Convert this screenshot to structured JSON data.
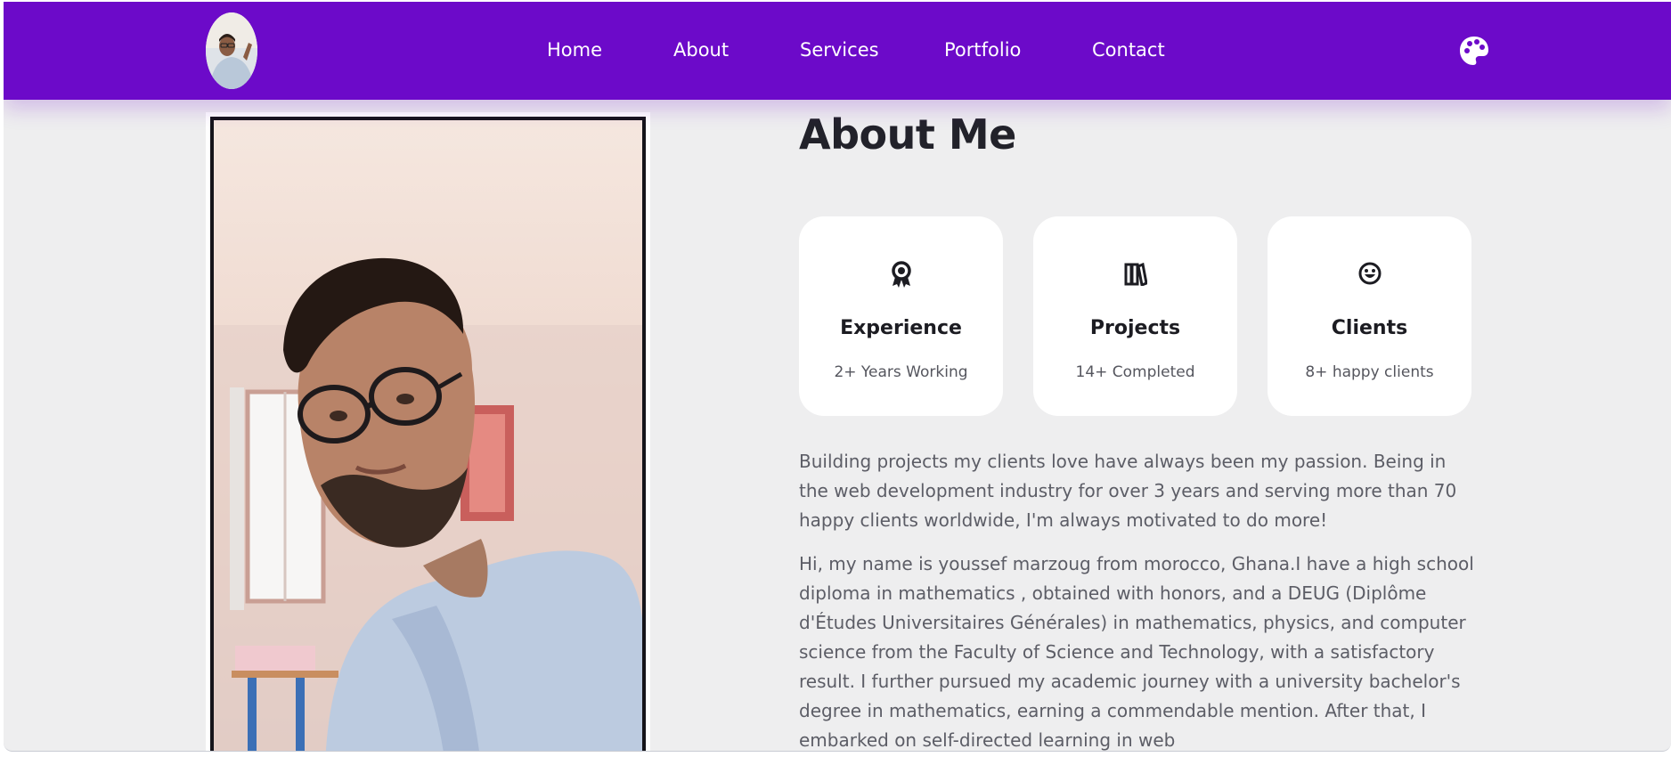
{
  "nav": {
    "logo_alt": "profile photo",
    "links": [
      {
        "label": "Home"
      },
      {
        "label": "About"
      },
      {
        "label": "Services"
      },
      {
        "label": "Portfolio"
      },
      {
        "label": "Contact"
      }
    ],
    "theme_icon": "palette-icon"
  },
  "about": {
    "title": "About Me",
    "cards": [
      {
        "icon": "award-icon",
        "title": "Experience",
        "subtitle": "2+ Years Working"
      },
      {
        "icon": "books-icon",
        "title": "Projects",
        "subtitle": "14+ Completed"
      },
      {
        "icon": "smile-icon",
        "title": "Clients",
        "subtitle": "8+ happy clients"
      }
    ],
    "paragraph1": "Building projects my clients love have always been my passion. Being in the web development industry for over 3 years and serving more than 70 happy clients worldwide, I'm always motivated to do more!",
    "paragraph2": "Hi, my name is youssef marzoug from morocco, Ghana.I have a high school diploma in mathematics , obtained with honors, and a DEUG (Diplôme d'Études Universitaires Générales) in mathematics, physics, and computer science from the Faculty of Science and Technology, with a satisfactory result. I further pursued my academic journey with a university bachelor's degree in mathematics, earning a commendable mention. After that, I embarked on self-directed learning in web"
  },
  "colors": {
    "nav_bg": "#6c0ac9",
    "page_bg": "#eeeeef",
    "card_bg": "#ffffff",
    "text_dark": "#1c1c22",
    "text_muted": "#5c5d66"
  }
}
